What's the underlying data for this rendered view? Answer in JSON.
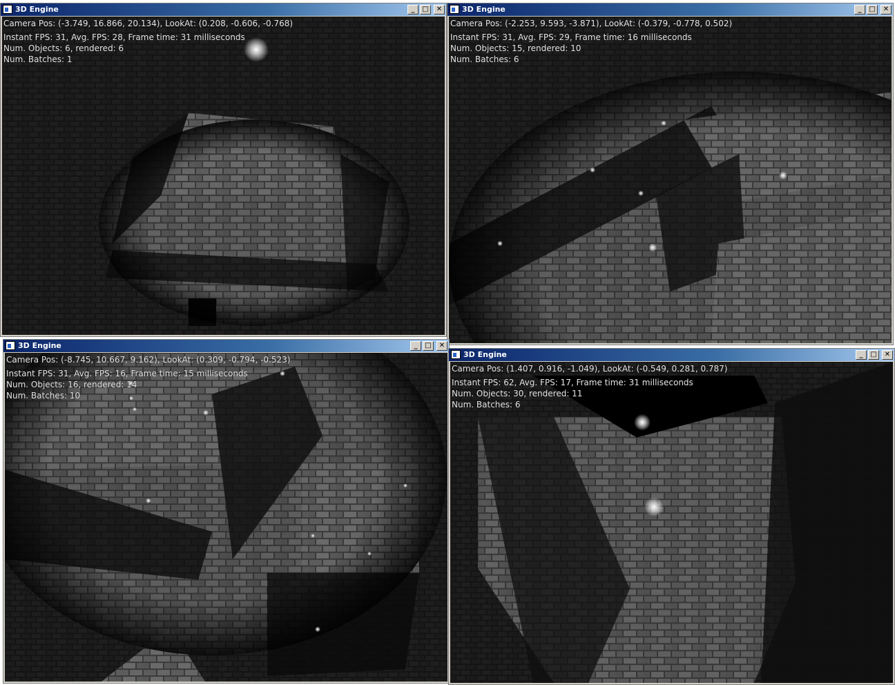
{
  "windows": [
    {
      "title": "3D Engine",
      "camera_line": "Camera Pos: (-3.749, 16.866, 20.134), LookAt: (0.208, -0.606, -0.768)",
      "fps_line": "Instant FPS: 31, Avg. FPS: 28, Frame time: 31 milliseconds",
      "objects_line": "Num. Objects: 6, rendered: 6",
      "batches_line": "Num. Batches: 1"
    },
    {
      "title": "3D Engine",
      "camera_line": "Camera Pos: (-2.253, 9.593, -3.871), LookAt: (-0.379, -0.778, 0.502)",
      "fps_line": "Instant FPS: 31, Avg. FPS: 29, Frame time: 16 milliseconds",
      "objects_line": "Num. Objects: 15, rendered: 10",
      "batches_line": "Num. Batches: 6"
    },
    {
      "title": "3D Engine",
      "camera_line": "Camera Pos: (-8.745, 10.667, 9.162), LookAt: (0.309, -0.794, -0.523)",
      "fps_line": "Instant FPS: 31, Avg. FPS: 16, Frame time: 15 milliseconds",
      "objects_line": "Num. Objects: 16, rendered: 14",
      "batches_line": "Num. Batches: 10"
    },
    {
      "title": "3D Engine",
      "camera_line": "Camera Pos: (1.407, 0.916, -1.049), LookAt: (-0.549, 0.281, 0.787)",
      "fps_line": "Instant FPS: 62, Avg. FPS: 17, Frame time: 31 milliseconds",
      "objects_line": "Num. Objects: 30, rendered: 11",
      "batches_line": "Num. Batches: 6"
    }
  ],
  "window_buttons": {
    "minimize": "_",
    "maximize": "□",
    "close": "✕"
  },
  "icons": [
    "window-app-icon",
    "minimize-icon",
    "maximize-icon",
    "close-icon"
  ]
}
